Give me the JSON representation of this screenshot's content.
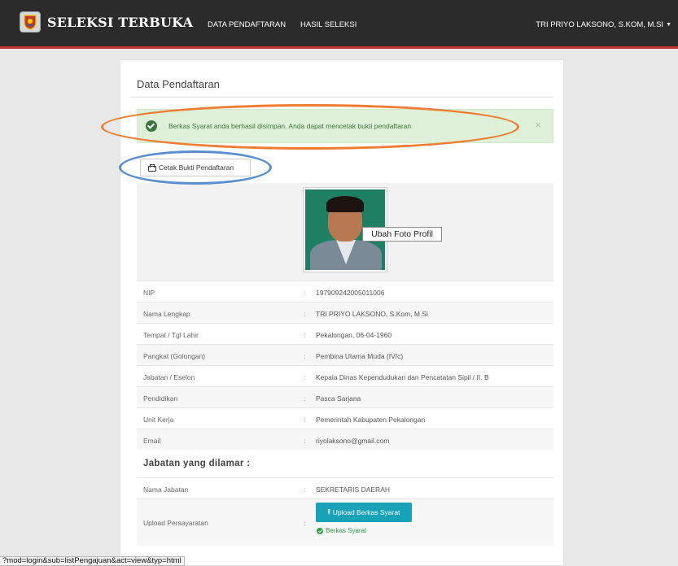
{
  "navbar": {
    "brand": "SELEKSI TERBUKA",
    "logo_icon": "crest-logo-icon",
    "links": [
      "DATA PENDAFTARAN",
      "HASIL SELEKSI"
    ],
    "user": "TRI PRIYO LAKSONO, S.KOM, M.SI",
    "user_caret_icon": "caret-down-icon"
  },
  "panel": {
    "title": "Data Pendaftaran",
    "alert": {
      "text": "Berkas Syarat anda berhasil disimpan. Anda dapat mencetak bukti pendaftaran",
      "close": "×"
    },
    "print_button": "Cetak Bukti Pendaftaran",
    "ubah_foto": "Ubah Foto Profil",
    "fields": [
      {
        "label": "NIP",
        "value": "197909242005011006"
      },
      {
        "label": "Nama Lengkap",
        "value": "TRI PRIYO LAKSONO, S.Kom, M.Si"
      },
      {
        "label": "Tempat / Tgl Lahir",
        "value": "Pekalongan, 06-04-1960"
      },
      {
        "label": "Pangkat (Golongan)",
        "value": "Pembina Utama Muda (IV/c)"
      },
      {
        "label": "Jabatan / Eselon",
        "value": "Kepala Dinas Kependudukan dan Pencatatan Sipil / II. B"
      },
      {
        "label": "Pendidikan",
        "value": "Pasca Sarjana"
      },
      {
        "label": "Unit Kerja",
        "value": "Pemerintah Kabupaten Pekalongan"
      },
      {
        "label": "Email",
        "value": "riyolaksono@gmail.com"
      }
    ],
    "section_title": "Jabatan yang dilamar :",
    "applied": [
      {
        "label": "Nama Jabatan",
        "value": "SEKRETARIS DAERAH"
      },
      {
        "label": "Upload Persayaratan",
        "value": ""
      }
    ],
    "upload_button": "Upload Berkas Syarat",
    "berkas_link": "Berkas Syarat",
    "separator": ":"
  },
  "statusbar": "?mod=login&sub=listPengajuan&act=view&typ=html",
  "colors": {
    "navbar": "#2b2b2b",
    "navbar_accent": "#c9332f",
    "alert_bg": "#dff0d8",
    "alert_text": "#3c763d",
    "upload_button": "#17a2b8",
    "annotation_orange": "#ee7d31",
    "annotation_blue": "#5a8fcf"
  }
}
